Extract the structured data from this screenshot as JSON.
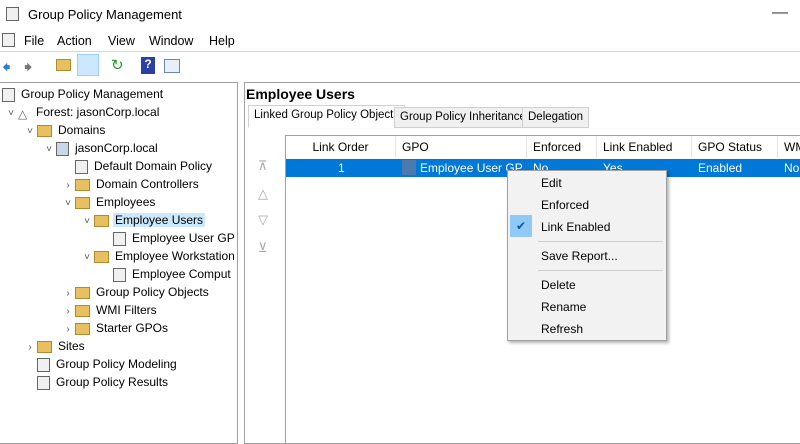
{
  "window": {
    "title": "Group Policy Management"
  },
  "menu": [
    "File",
    "Action",
    "View",
    "Window",
    "Help"
  ],
  "tree": [
    {
      "label": "Group Policy Management",
      "indent": 0,
      "chev": "",
      "icon": "doc"
    },
    {
      "label": "Forest: jasonCorp.local",
      "indent": 0,
      "chev": "v",
      "icon": "forest"
    },
    {
      "label": "Domains",
      "indent": 1,
      "chev": "v",
      "icon": "folder"
    },
    {
      "label": "jasonCorp.local",
      "indent": 2,
      "chev": "v",
      "icon": "domain"
    },
    {
      "label": "Default Domain Policy",
      "indent": 3,
      "chev": "",
      "icon": "doc"
    },
    {
      "label": "Domain Controllers",
      "indent": 3,
      "chev": ">",
      "icon": "folder"
    },
    {
      "label": "Employees",
      "indent": 3,
      "chev": "v",
      "icon": "folder"
    },
    {
      "label": "Employee Users",
      "indent": 4,
      "chev": "v",
      "icon": "folder",
      "selected": true
    },
    {
      "label": "Employee User GP",
      "indent": 5,
      "chev": "",
      "icon": "doc"
    },
    {
      "label": "Employee Workstation",
      "indent": 4,
      "chev": "v",
      "icon": "folder"
    },
    {
      "label": "Employee Comput",
      "indent": 5,
      "chev": "",
      "icon": "doc"
    },
    {
      "label": "Group Policy Objects",
      "indent": 3,
      "chev": ">",
      "icon": "folder"
    },
    {
      "label": "WMI Filters",
      "indent": 3,
      "chev": ">",
      "icon": "folder"
    },
    {
      "label": "Starter GPOs",
      "indent": 3,
      "chev": ">",
      "icon": "folder"
    },
    {
      "label": "Sites",
      "indent": 1,
      "chev": ">",
      "icon": "folder"
    },
    {
      "label": "Group Policy Modeling",
      "indent": 1,
      "chev": "",
      "icon": "doc"
    },
    {
      "label": "Group Policy Results",
      "indent": 1,
      "chev": "",
      "icon": "doc"
    }
  ],
  "main": {
    "heading": "Employee Users",
    "tabs": [
      "Linked Group Policy Objects",
      "Group Policy Inheritance",
      "Delegation"
    ],
    "columns": [
      "Link Order",
      "GPO",
      "Enforced",
      "Link Enabled",
      "GPO Status",
      "WMI"
    ],
    "row": {
      "order": "1",
      "gpo": "Employee User GP",
      "enforced": "No",
      "link_enabled": "Yes",
      "status": "Enabled",
      "wmi": "None"
    }
  },
  "context_menu": {
    "items": [
      "Edit",
      "Enforced",
      "Link Enabled",
      "Save Report...",
      "Delete",
      "Rename",
      "Refresh"
    ],
    "checked": "Link Enabled"
  },
  "colors": {
    "selection": "#0078d7",
    "tree_selection": "#cce8ff"
  }
}
